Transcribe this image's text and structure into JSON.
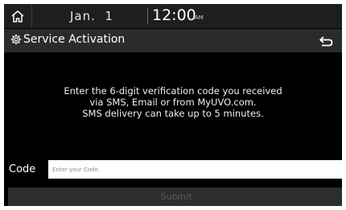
{
  "status_bar": {
    "date": "Jan.  1",
    "time": "12:00",
    "ampm": "AM"
  },
  "header": {
    "title": "Service Activation",
    "icons": {
      "home": "home-icon",
      "settings": "gear-icon",
      "back": "back-arrow-icon"
    }
  },
  "main": {
    "message_lines": [
      "Enter the 6-digit verification code you received",
      "via SMS, Email or from MyUVO.com.",
      "SMS delivery can take up to 5 minutes."
    ],
    "code_label": "Code",
    "code_value": "",
    "code_placeholder": "Enter your Code.",
    "submit_label": "Submit"
  },
  "colors": {
    "background": "#000000",
    "status_bar": "#1e1e1e",
    "title_bar": "#2b2b2b",
    "submit_disabled": "#2e2e2e"
  }
}
